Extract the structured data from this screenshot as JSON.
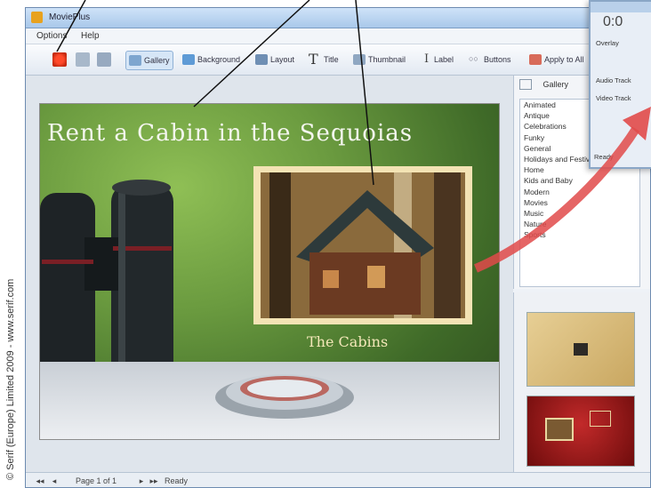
{
  "credit": "© Serif (Europe) Limited 2009 - www.serif.com",
  "window": {
    "title": "MoviePlus"
  },
  "menu": [
    "Options",
    "Help"
  ],
  "toolbar": {
    "buttons": [
      {
        "label": "Gallery"
      },
      {
        "label": "Background"
      },
      {
        "label": "Layout"
      },
      {
        "label": "Title"
      },
      {
        "label": "Thumbnail"
      },
      {
        "label": "Label"
      },
      {
        "label": "Buttons"
      },
      {
        "label": "Apply to All"
      }
    ]
  },
  "canvas": {
    "headline": "Rent a Cabin in the Sequoias",
    "caption": "The Cabins"
  },
  "gallery": {
    "header": "Gallery",
    "items": [
      "Animated",
      "Antique",
      "Celebrations",
      "Funky",
      "General",
      "Holidays and Festivals",
      "Home",
      "Kids and Baby",
      "Modern",
      "Movies",
      "Music",
      "Nature",
      "Sports"
    ]
  },
  "status": {
    "page": "Page 1 of 1",
    "state": "Ready"
  },
  "popup": {
    "time": "0:0",
    "rows": [
      "Overlay",
      "Audio Track",
      "Video Track"
    ],
    "ready": "Ready"
  },
  "colors": {
    "accent": "#e14a4a",
    "titlebar": "#a9c8ea"
  }
}
